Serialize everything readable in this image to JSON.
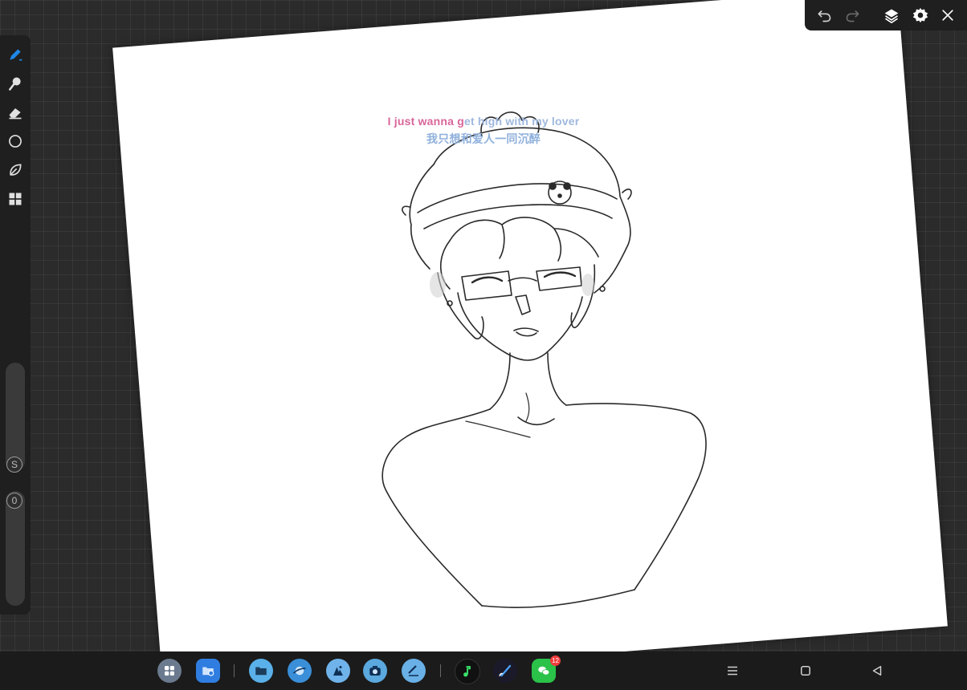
{
  "lyrics": {
    "line1_part1": "I just wanna g",
    "line1_part2": "et high with my lover",
    "line2": "我只想和爱人一同沉醉"
  },
  "left_toolbar": {
    "tools": [
      {
        "name": "brush-tool",
        "icon": "pen-icon",
        "active": true
      },
      {
        "name": "smudge-tool",
        "icon": "smudge-icon"
      },
      {
        "name": "eraser-tool",
        "icon": "eraser-icon"
      },
      {
        "name": "shape-tool",
        "icon": "circle-icon"
      },
      {
        "name": "lasso-tool",
        "icon": "lasso-icon"
      },
      {
        "name": "adjust-tool",
        "icon": "grid-icon"
      }
    ],
    "size_label": "S",
    "opacity_label": "0"
  },
  "top_toolbar": {
    "buttons": [
      "undo-icon",
      "redo-icon",
      "layers-icon",
      "gear-icon",
      "close-icon"
    ]
  },
  "dock": {
    "apps": [
      "app-grid",
      "files",
      "file-manager",
      "browser",
      "gallery",
      "camera",
      "notes",
      "music",
      "paint",
      "wechat"
    ],
    "wechat_badge": "12",
    "nav": [
      "menu-icon",
      "home-icon",
      "back-icon"
    ]
  },
  "colors": {
    "accent": "#1e88e5",
    "lyric_pink": "#d9669a",
    "lyric_blue": "#8fb0dc",
    "toolbar": "#1f1f1f",
    "background": "#2b2b2b"
  }
}
